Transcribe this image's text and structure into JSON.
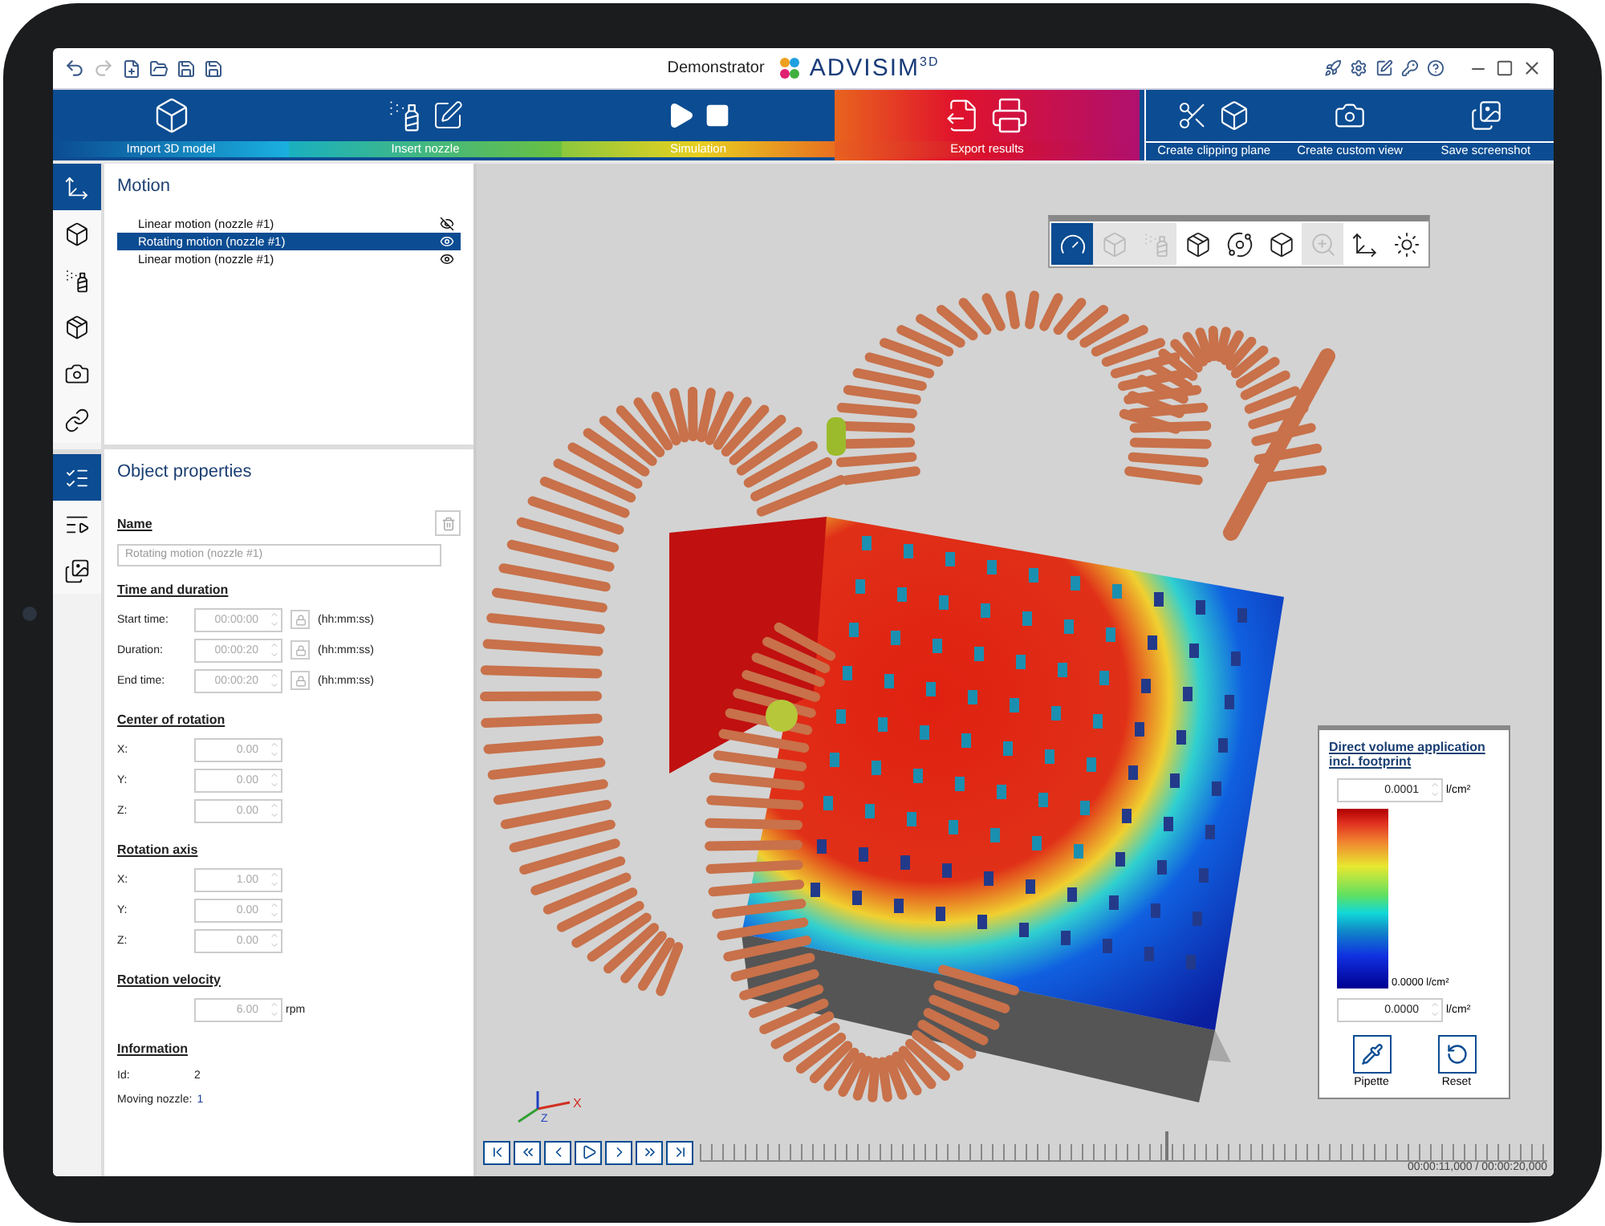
{
  "title_bar": {
    "app_title": "Demonstrator",
    "logo_text": "ADVISIM$^{3D}$"
  },
  "workflow_steps": [
    {
      "label": "Import 3D model",
      "kind": "import"
    },
    {
      "label": "Insert nozzle",
      "kind": "nozzle"
    },
    {
      "label": "Simulation",
      "kind": "simulation"
    },
    {
      "label": "Export results",
      "kind": "export"
    }
  ],
  "view_tools": [
    {
      "label": "Create clipping plane",
      "kind": "clipping"
    },
    {
      "label": "Create custom view",
      "kind": "custom-view"
    },
    {
      "label": "Save screenshot",
      "kind": "screenshot"
    }
  ],
  "sidebar_top": [
    {
      "kind": "motion",
      "selected": true
    },
    {
      "kind": "model",
      "selected": false
    },
    {
      "kind": "nozzle",
      "selected": false
    },
    {
      "kind": "clipping",
      "selected": false
    },
    {
      "kind": "camera",
      "selected": false
    },
    {
      "kind": "link",
      "selected": false
    }
  ],
  "sidebar_bottom": [
    {
      "kind": "properties",
      "selected": true
    },
    {
      "kind": "playback",
      "selected": false
    },
    {
      "kind": "results",
      "selected": false
    }
  ],
  "motion": {
    "title": "Motion",
    "items": [
      {
        "label": "Linear motion (nozzle #1)",
        "selected": false,
        "visible": false
      },
      {
        "label": "Rotating motion (nozzle #1)",
        "selected": true,
        "visible": true
      },
      {
        "label": "Linear motion (nozzle #1)",
        "selected": false,
        "visible": true
      }
    ]
  },
  "properties": {
    "title": "Object properties",
    "name_heading": "Name",
    "name_value": "Rotating motion (nozzle #1)",
    "sections": [
      {
        "kind": "time",
        "disabled": true,
        "heading": "Time and duration",
        "rows": [
          {
            "label": "Start time:",
            "value": "00:00:00",
            "unit": "(hh:mm:ss)"
          },
          {
            "label": "Duration:",
            "value": "00:00:20",
            "unit": "(hh:mm:ss)"
          },
          {
            "label": "End time:",
            "value": "00:00:20",
            "unit": "(hh:mm:ss)"
          }
        ]
      },
      {
        "kind": "vector",
        "disabled": true,
        "heading": "Center of rotation",
        "rows": [
          {
            "label": "X:",
            "value": "0.00"
          },
          {
            "label": "Y:",
            "value": "0.00"
          },
          {
            "label": "Z:",
            "value": "0.00"
          }
        ]
      },
      {
        "kind": "vector",
        "disabled": true,
        "heading": "Rotation axis",
        "rows": [
          {
            "label": "X:",
            "value": "1.00"
          },
          {
            "label": "Y:",
            "value": "0.00"
          },
          {
            "label": "Z:",
            "value": "0.00"
          }
        ]
      },
      {
        "kind": "vector",
        "disabled": true,
        "heading": "Rotation velocity",
        "rows": [
          {
            "value": "6.00",
            "unit": "rpm"
          }
        ]
      },
      {
        "kind": "info",
        "heading": "Information",
        "rows": [
          {
            "label": "Id:",
            "value": "2"
          },
          {
            "label": "Moving nozzle:",
            "value": "1"
          }
        ]
      }
    ]
  },
  "view_toolbar": [
    {
      "kind": "view-angle",
      "selected": true,
      "disabled": false
    },
    {
      "kind": "cube-view",
      "selected": false,
      "disabled": true
    },
    {
      "kind": "nozzle-view",
      "selected": false,
      "disabled": true
    },
    {
      "kind": "clip-view",
      "selected": false,
      "disabled": false
    },
    {
      "kind": "orbit",
      "selected": false,
      "disabled": false
    },
    {
      "kind": "wireframe",
      "selected": false,
      "disabled": false
    },
    {
      "kind": "zoom-fit",
      "selected": false,
      "disabled": true
    },
    {
      "kind": "axes",
      "selected": false,
      "disabled": false
    },
    {
      "kind": "lighting",
      "selected": false,
      "disabled": false
    }
  ],
  "legend": {
    "title": "Direct volume application incl. footprint",
    "max_value": "0.0001",
    "unit": "l/cm²",
    "min_label": "0.0000 l/cm²",
    "min_value": "0.0000",
    "min_unit": "l/cm²",
    "buttons": [
      {
        "label": "Pipette",
        "kind": "pipette"
      },
      {
        "label": "Reset",
        "kind": "reset"
      }
    ]
  },
  "axes": {
    "x_label": "X",
    "z_label": "Z"
  },
  "timeline": {
    "controls": [
      {
        "kind": "first"
      },
      {
        "kind": "fast-back"
      },
      {
        "kind": "back"
      },
      {
        "kind": "play"
      },
      {
        "kind": "forward"
      },
      {
        "kind": "fast-forward"
      },
      {
        "kind": "last"
      }
    ],
    "time": "00:00:11,000 / 00:00:20,000",
    "level": 0.55
  }
}
